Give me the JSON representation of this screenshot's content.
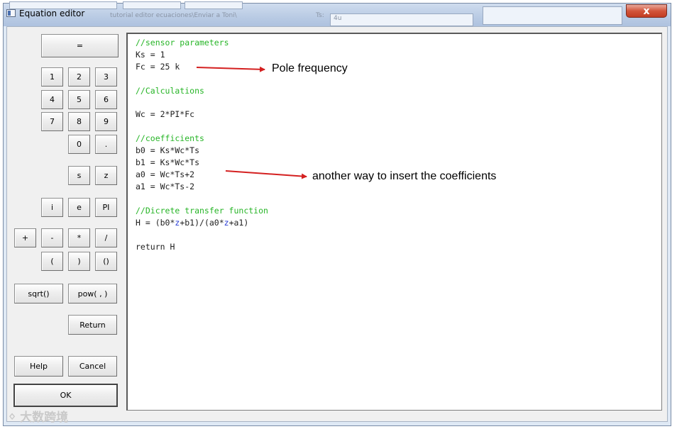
{
  "window": {
    "title": "Equation editor",
    "close_symbol": "x",
    "background_text": [
      "tutorial editor ecuaciones\\Enviar a Toni\\",
      "Ts:",
      "4u"
    ]
  },
  "buttons": {
    "equals": "=",
    "d1": "1",
    "d2": "2",
    "d3": "3",
    "d4": "4",
    "d5": "5",
    "d6": "6",
    "d7": "7",
    "d8": "8",
    "d9": "9",
    "d0": "0",
    "dot": ".",
    "s": "s",
    "z": "z",
    "i": "i",
    "e": "e",
    "pi": "PI",
    "plus": "+",
    "minus": "-",
    "times": "*",
    "divide": "/",
    "lparen": "(",
    "rparen": ")",
    "parens": "()",
    "sqrt": "sqrt()",
    "pow": "pow( , )",
    "return": "Return",
    "help": "Help",
    "cancel": "Cancel",
    "ok": "OK"
  },
  "editor": {
    "lines": [
      "//sensor parameters",
      "Ks = 1",
      "Fc = 25 k",
      "//Calculations",
      "Wc = 2*PI*Fc",
      "//coefficients",
      "b0 = Ks*Wc*Ts",
      "b1 = Ks*Wc*Ts",
      "a0 = Wc*Ts+2",
      "a1 = Wc*Ts-2",
      "//Dicrete transfer function",
      "return H"
    ],
    "transfer_line": {
      "prefix": "H = (b0*",
      "var1": "z",
      "middle": "+b1)/(a0*",
      "var2": "z",
      "suffix": "+a1)"
    }
  },
  "annotations": {
    "pole": "Pole frequency",
    "coeff": "another way to insert the coefficients",
    "arrow_color": "#d42020"
  },
  "watermark": "大数跨境"
}
